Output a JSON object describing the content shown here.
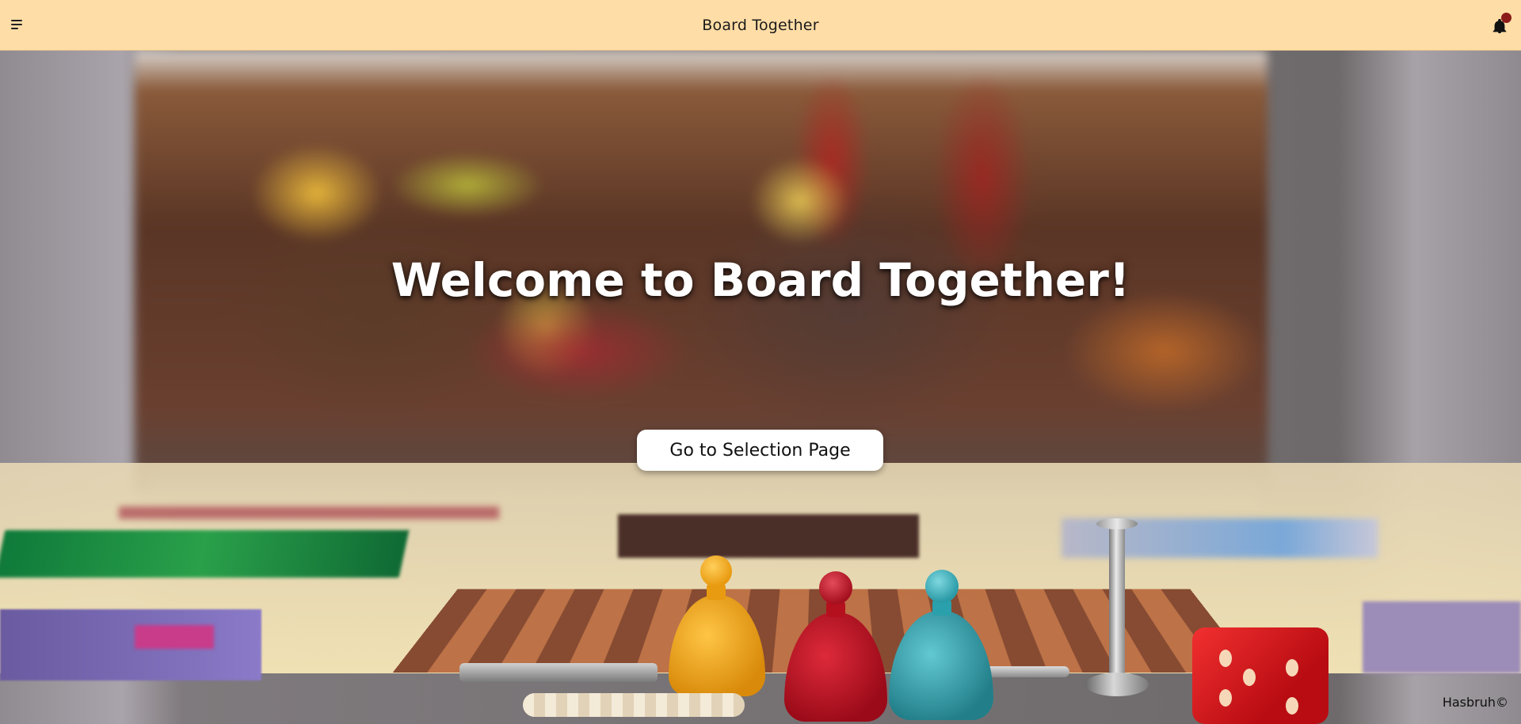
{
  "header": {
    "title": "Board Together",
    "menu_icon": "hamburger-menu-icon",
    "notification_icon": "bell-icon",
    "notification_dot_color": "#8b1a1a",
    "background_color": "#ffdda6"
  },
  "hero": {
    "welcome_text": "Welcome to Board Together!",
    "cta_label": "Go to Selection Page"
  },
  "footer": {
    "brand": "Hasbruh©"
  }
}
